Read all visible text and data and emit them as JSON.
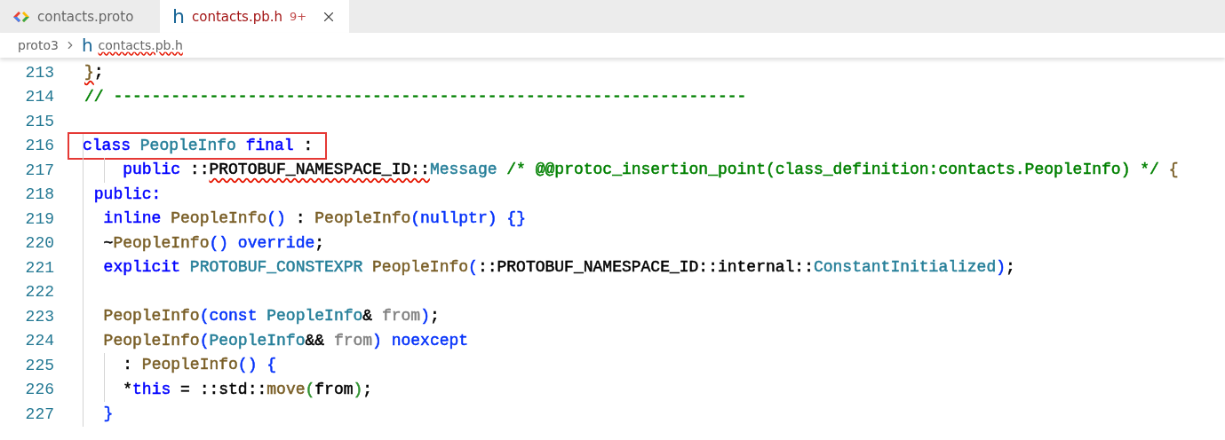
{
  "tabs": [
    {
      "kind": "proto",
      "label": "contacts.proto",
      "selected": false,
      "has_errors": false
    },
    {
      "kind": "header",
      "glyph": "h",
      "label": "contacts.pb.h",
      "selected": true,
      "has_errors": true,
      "problems": "9+",
      "close": true
    }
  ],
  "breadcrumb": [
    {
      "label": "proto3",
      "error": false
    },
    {
      "glyph": "h",
      "label": "contacts.pb.h",
      "error": true
    }
  ],
  "lines": [
    {
      "number": "213",
      "highlighted": false,
      "segments": [
        {
          "t": "}",
          "color": "#795e26",
          "error": true
        },
        {
          "t": ";",
          "color": "#000000",
          "error": false
        }
      ]
    },
    {
      "number": "214",
      "highlighted": false,
      "segments": [
        {
          "t": "// ------------------------------------------------------------------",
          "color": "#008000",
          "error": false
        }
      ]
    },
    {
      "number": "215"
    },
    {
      "number": "216",
      "highlighted": true,
      "segments": [
        {
          "t": "class ",
          "color": "#0000ff",
          "error": false
        },
        {
          "t": "PeopleInfo ",
          "color": "#267f99",
          "error": false
        },
        {
          "t": "final",
          "color": "#0000ff",
          "error": false
        },
        {
          "t": " :",
          "color": "#000000",
          "error": false
        }
      ]
    },
    {
      "number": "217",
      "highlighted": false,
      "segments": [
        {
          "t": "    public",
          "color": "#0000ff",
          "error": false
        },
        {
          "t": " ::",
          "color": "#000000",
          "error": false
        },
        {
          "t": "PROTOBUF_NAMESPACE_ID::",
          "color": "#000000",
          "error": true
        },
        {
          "t": "Message",
          "color": "#267f99",
          "error": false
        },
        {
          "t": " /* @@protoc_insertion_point(class_definition:contacts.PeopleInfo) */ ",
          "color": "#008000",
          "error": false
        },
        {
          "t": "{",
          "color": "#795e26",
          "error": false
        }
      ]
    },
    {
      "number": "218",
      "highlighted": false,
      "segments": [
        {
          "t": " public:",
          "color": "#0000ff",
          "error": false
        }
      ]
    },
    {
      "number": "219",
      "highlighted": false,
      "segments": [
        {
          "t": "  inline ",
          "color": "#0000ff",
          "error": false
        },
        {
          "t": "PeopleInfo",
          "color": "#795e26",
          "error": false
        },
        {
          "t": "()",
          "color": "#0431fa",
          "error": false
        },
        {
          "t": " : ",
          "color": "#000000",
          "error": false
        },
        {
          "t": "PeopleInfo",
          "color": "#795e26",
          "error": false
        },
        {
          "t": "(nullptr) {}",
          "color": "#0431fa",
          "error": false
        }
      ]
    },
    {
      "number": "220",
      "highlighted": false,
      "segments": [
        {
          "t": "  ~",
          "color": "#000000",
          "error": false
        },
        {
          "t": "PeopleInfo",
          "color": "#795e26",
          "error": false
        },
        {
          "t": "() override",
          "color": "#0431fa",
          "error": false
        },
        {
          "t": ";",
          "color": "#000000",
          "error": false
        }
      ]
    },
    {
      "number": "221",
      "highlighted": false,
      "segments": [
        {
          "t": "  explicit ",
          "color": "#0000ff",
          "error": false
        },
        {
          "t": "PROTOBUF_CONSTEXPR ",
          "color": "#267f99",
          "error": false
        },
        {
          "t": "PeopleInfo",
          "color": "#795e26",
          "error": false
        },
        {
          "t": "(",
          "color": "#0431fa",
          "error": false
        },
        {
          "t": "::PROTOBUF_NAMESPACE_ID::internal::",
          "color": "#000000",
          "error": false
        },
        {
          "t": "ConstantInitialized",
          "color": "#267f99",
          "error": false
        },
        {
          "t": ")",
          "color": "#0431fa",
          "error": false
        },
        {
          "t": ";",
          "color": "#000000",
          "error": false
        }
      ]
    },
    {
      "number": "222"
    },
    {
      "number": "223",
      "highlighted": false,
      "segments": [
        {
          "t": "  PeopleInfo",
          "color": "#795e26",
          "error": false
        },
        {
          "t": "(const ",
          "color": "#0431fa",
          "error": false
        },
        {
          "t": "PeopleInfo",
          "color": "#267f99",
          "error": false
        },
        {
          "t": "& ",
          "color": "#000000",
          "error": false
        },
        {
          "t": "from",
          "color": "#808080",
          "error": false
        },
        {
          "t": ")",
          "color": "#0431fa",
          "error": false
        },
        {
          "t": ";",
          "color": "#000000",
          "error": false
        }
      ]
    },
    {
      "number": "224",
      "highlighted": false,
      "segments": [
        {
          "t": "  PeopleInfo",
          "color": "#795e26",
          "error": false
        },
        {
          "t": "(",
          "color": "#0431fa",
          "error": false
        },
        {
          "t": "PeopleInfo",
          "color": "#267f99",
          "error": false
        },
        {
          "t": "&& ",
          "color": "#000000",
          "error": false
        },
        {
          "t": "from",
          "color": "#808080",
          "error": false
        },
        {
          "t": ") noexcept",
          "color": "#0431fa",
          "error": false
        }
      ]
    },
    {
      "number": "225",
      "highlighted": false,
      "segments": [
        {
          "t": "    : ",
          "color": "#000000",
          "error": false
        },
        {
          "t": "PeopleInfo",
          "color": "#795e26",
          "error": false
        },
        {
          "t": "() {",
          "color": "#0431fa",
          "error": false
        }
      ]
    },
    {
      "number": "226",
      "highlighted": false,
      "segments": [
        {
          "t": "    *",
          "color": "#000000",
          "error": false
        },
        {
          "t": "this",
          "color": "#0000ff",
          "error": false
        },
        {
          "t": " = ::std::",
          "color": "#000000",
          "error": false
        },
        {
          "t": "move",
          "color": "#795e26",
          "error": false
        },
        {
          "t": "(",
          "color": "#319331",
          "error": false
        },
        {
          "t": "from",
          "color": "#000000",
          "error": false
        },
        {
          "t": ")",
          "color": "#319331",
          "error": false
        },
        {
          "t": ";",
          "color": "#000000",
          "error": false
        }
      ]
    },
    {
      "number": "227",
      "highlighted": false,
      "segments": [
        {
          "t": "  }",
          "color": "#0431fa",
          "error": false
        }
      ]
    }
  ]
}
